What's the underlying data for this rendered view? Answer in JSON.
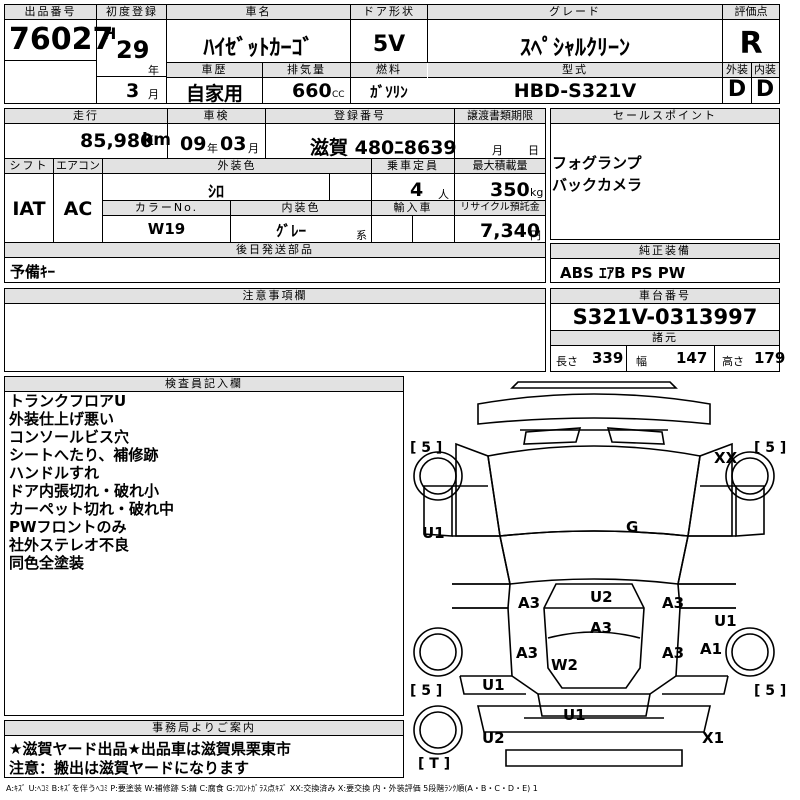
{
  "labels": {
    "lot_no": "出品番号",
    "first_reg": "初度登録",
    "car_name": "車名",
    "door_type": "ドア形状",
    "grade": "グレード",
    "score": "評価点",
    "history": "車歴",
    "displacement": "排気量",
    "fuel": "燃料",
    "model": "型式",
    "exterior": "外装",
    "interior": "内装",
    "mileage": "走行",
    "inspection": "車検",
    "plate": "登録番号",
    "transfer_doc": "譲渡書類期限",
    "sales_point": "セールスポイント",
    "shift": "シフト",
    "aircon": "エアコン",
    "ext_color": "外装色",
    "capacity": "乗車定員",
    "max_load": "最大積載量",
    "color_no": "カラーNo.",
    "int_color": "内装色",
    "import": "輸入車",
    "recycle": "リサイクル預託金",
    "later_parts": "後日発送部品",
    "genuine_equip": "純正装備",
    "caution": "注意事項欄",
    "chassis_no": "車台番号",
    "specs": "諸元",
    "inspector_notes": "検査員記入欄",
    "office_notice": "事務局よりご案内"
  },
  "units": {
    "year": "年",
    "month": "月",
    "cc": "CC",
    "km": "km",
    "day": "日",
    "persons": "人",
    "kg": "kg",
    "yen": "円",
    "kei": "系",
    "length": "長さ",
    "width": "幅",
    "height": "高さ"
  },
  "vehicle": {
    "lot_no": "76027",
    "era": "H",
    "year": "29",
    "month": "3",
    "name": "ﾊｲｾﾞｯﾄｶｰｺﾞ",
    "door": "5V",
    "grade": "ｽﾍﾟｼｬﾙｸﾘｰﾝ",
    "score": "R",
    "history": "自家用",
    "displacement": "660",
    "fuel": "ｶﾞｿﾘﾝ",
    "model": "HBD-S321V",
    "exterior": "D",
    "interior": "D",
    "mileage": "85,980",
    "inspection_year": "09",
    "inspection_month": "03",
    "plate": "滋賀 480ﾆ8639",
    "shift": "IAT",
    "aircon": "AC",
    "ext_color": "ｼﾛ",
    "capacity": "4",
    "max_load": "350",
    "color_no": "W19",
    "int_color": "ｸﾞﾚｰ",
    "recycle": "7,340",
    "later_parts": "予備ｷｰ",
    "sales_points": [
      "フォグランプ",
      "バックカメラ"
    ],
    "genuine_equip": "ABS ｴｱB PS PW",
    "chassis_no": "S321V-0313997",
    "length": "339",
    "width": "147",
    "height": "179"
  },
  "inspector_notes": [
    "トランクフロアU",
    "外装仕上げ悪い",
    "コンソールビス穴",
    "シートへたり、補修跡",
    "ハンドルすれ",
    "ドア内張切れ・破れ小",
    "カーペット切れ・破れ中",
    "PWフロントのみ",
    "社外ステレオ不良",
    "同色全塗装"
  ],
  "office_notice": [
    "★滋賀ヤード出品★出品車は滋賀県栗東市",
    "注意：搬出は滋賀ヤードになります"
  ],
  "diagram_marks": {
    "tire_fl": "[ 5 ]",
    "tire_fr": "[ 5 ]",
    "tire_rl": "[ 5 ]",
    "tire_rr": "[ 5 ]",
    "spare": "[ T ]",
    "xx": "XX",
    "g": "G",
    "u1_left": "U1",
    "u2_center": "U2",
    "a3_left": "A3",
    "a3_right": "A3",
    "u1_right": "U1",
    "a3_center": "A3",
    "a3_left_rear": "A3",
    "a3_right_rear": "A3",
    "a1": "A1",
    "w2": "W2",
    "u1_rear_left": "U1",
    "u1_bumper": "U1",
    "u2_bottom": "U2",
    "x1": "X1"
  },
  "legend": "A:ｷｽﾞ U:ﾍｺﾐ B:ｷｽﾞを伴うﾍｺﾐ P:要塗装 W:補修跡 S:錆 C:腐食 G:ﾌﾛﾝﾄｶﾞﾗｽ点ｷｽﾞ XX:交換済み X:要交換 内・外装評価 5段階ﾗﾝｸ順(A・B・C・D・E) 1"
}
